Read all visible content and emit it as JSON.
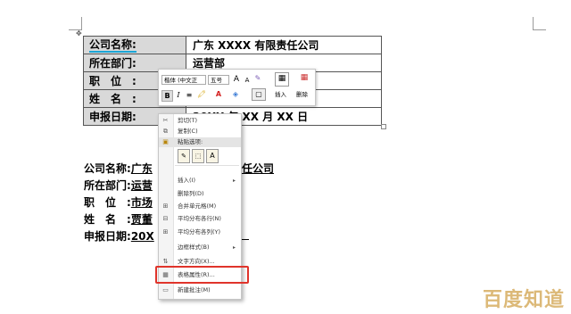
{
  "table": {
    "rows": [
      {
        "label": "公司名称:",
        "value": "广东 XXXX 有限责任公司"
      },
      {
        "label": "所在部门:",
        "value": "运营部"
      },
      {
        "label": "职　位　:",
        "value": ""
      },
      {
        "label": "姓　名　:",
        "value": ""
      },
      {
        "label": "申报日期:",
        "value": "20XX 年 XX 月 XX 日"
      }
    ]
  },
  "body_lines": [
    {
      "label": "公司名称:",
      "value": "广东",
      "tail": "任公司"
    },
    {
      "label": "所在部门:",
      "value": "运营"
    },
    {
      "label": "职　位　:",
      "value": "市场"
    },
    {
      "label": "姓　名　:",
      "value": "贾董"
    },
    {
      "label": "申报日期:",
      "value": "20X"
    }
  ],
  "toolbar": {
    "font_name": "楷体 (中文正",
    "font_size": "五号",
    "grow_font": "A",
    "shrink_font": "A",
    "bold": "B",
    "italic": "I",
    "font_color": "A",
    "insert_label": "插入",
    "delete_label": "删除"
  },
  "context_menu": {
    "items": [
      {
        "label": "剪切(T)",
        "icon": "scissors-icon",
        "glyph": "✂"
      },
      {
        "label": "复制(C)",
        "icon": "copy-icon",
        "glyph": "⧉"
      },
      {
        "label": "粘贴选项:",
        "icon": "paste-icon",
        "glyph": "📋"
      },
      {
        "label": "插入(I)",
        "icon": "",
        "glyph": "",
        "submenu": true
      },
      {
        "label": "删除列(D)",
        "icon": "",
        "glyph": ""
      },
      {
        "label": "合并单元格(M)",
        "icon": "merge-cells-icon",
        "glyph": "⊞"
      },
      {
        "label": "平均分布各行(N)",
        "icon": "distribute-rows-icon",
        "glyph": "⊟"
      },
      {
        "label": "平均分布各列(Y)",
        "icon": "distribute-columns-icon",
        "glyph": "⊞"
      },
      {
        "label": "边框样式(B)",
        "icon": "",
        "glyph": "",
        "submenu": true
      },
      {
        "label": "文字方向(X)...",
        "icon": "text-direction-icon",
        "glyph": "⇅"
      },
      {
        "label": "表格属性(R)...",
        "icon": "table-properties-icon",
        "glyph": "▦"
      },
      {
        "label": "新建批注(M)",
        "icon": "comment-icon",
        "glyph": "▭"
      }
    ]
  },
  "watermark": "百度知道",
  "colors": {
    "accent_blue": "#1aa5d6",
    "highlight_red": "#e0342b",
    "label_cell_bg": "#d9d9d9"
  }
}
